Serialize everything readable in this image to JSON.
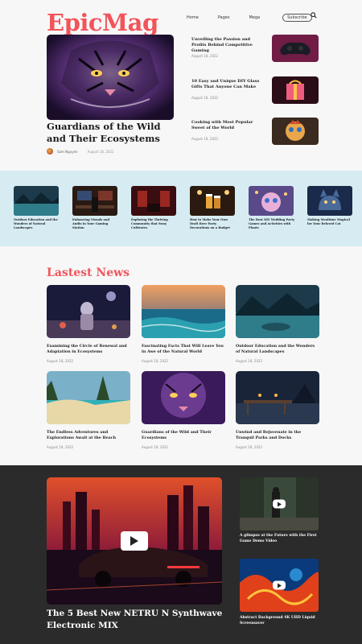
{
  "header": {
    "logo": "EpicMag",
    "nav": [
      "Home",
      "Pages",
      "Mega"
    ],
    "subscribe": "Subscribe"
  },
  "hero": {
    "title": "Guardians of the Wild and Their Ecosystems",
    "author": "Sam Nguyen",
    "date": "August 18, 2022",
    "image": "tiger-art"
  },
  "side_articles": [
    {
      "title": "Unveiling the Passion and Profits Behind Competitive Gaming",
      "date": "August 18, 2022",
      "image": "gamepad"
    },
    {
      "title": "10 Easy and Unique DIY Glass Gifts That Anyone Can Make",
      "date": "August 18, 2022",
      "image": "glowing-gift"
    },
    {
      "title": "Cooking with Most Popular Sweet of the World",
      "date": "August 18, 2022",
      "image": "cute-toy"
    }
  ],
  "strip": [
    {
      "title": "Outdoor Education and the Wonders of Natural Landscapes",
      "image": "lake"
    },
    {
      "title": "Enhancing Visuals and Audio in Your Gaming Station",
      "image": "gaming-room"
    },
    {
      "title": "Exploring the Thriving Community that Sway Cultivates",
      "image": "red-room"
    },
    {
      "title": "How to Make Your Own Draft Beer Party Decorations on a Budget",
      "image": "beer"
    },
    {
      "title": "The Best DIY Wedding Party Games and Activities with Plants",
      "image": "fluffy-creature"
    },
    {
      "title": "Making Mealtime Magical for Your Beloved Cat",
      "image": "cat"
    }
  ],
  "latest": {
    "heading": "Lastest News",
    "items": [
      {
        "title": "Examining the Circle of Renewal and Adaptation in Ecosystems",
        "date": "August 18, 2022",
        "image": "astronaut"
      },
      {
        "title": "Fascinating Facts That Will Leave You in Awe of the Natural World",
        "date": "August 18, 2022",
        "image": "ocean-sunset"
      },
      {
        "title": "Outdoor Education and the Wonders of Natural Landscapes",
        "date": "August 18, 2022",
        "image": "lake"
      },
      {
        "title": "The Endless Adventures and Explorations Await at the Beach",
        "date": "August 18, 2022",
        "image": "beach"
      },
      {
        "title": "Guardians of the Wild and Their Ecosystems",
        "date": "August 18, 2022",
        "image": "tiger-art"
      },
      {
        "title": "Unwind and Rejuvenate in the Tranquil Parks and Docks",
        "date": "August 18, 2022",
        "image": "dock"
      }
    ]
  },
  "videos": {
    "main": {
      "title": "The 5 Best New NETRU N Synthwave Electronic MIX",
      "image": "synthwave-car"
    },
    "side": [
      {
        "title": "A glimpse at the Future with the First Game Demo Video",
        "image": "game-scene"
      },
      {
        "title": "Abstract Background 4K UHD Liquid Screensaver",
        "image": "liquid-abstract"
      }
    ]
  },
  "colors": {
    "accent": "#f2545b",
    "strip_bg": "#d6ecf2",
    "dark_bg": "#2b2b2b"
  }
}
